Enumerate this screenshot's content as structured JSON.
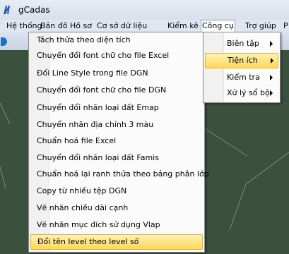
{
  "window": {
    "title": "gCadas"
  },
  "menubar": {
    "items": [
      "Hệ thống",
      "Bản đồ",
      "Hồ sơ",
      "Cơ sở dữ liệu",
      "Kiểm kê",
      "Công cụ",
      "Trợ giúp",
      "P"
    ],
    "active": "Công cụ"
  },
  "dropdown": {
    "items": [
      "Tách thửa theo diện tích",
      "Chuyển đổi font chữ cho file Excel",
      "Đổi Line Style trong file DGN",
      "Chuyển đổi font chữ cho file DGN",
      "Chuyển đổi nhãn loại đất Emap",
      "Chuyển nhãn địa chính 3 màu",
      "Chuẩn hoá file Excel",
      "Chuyển đổi nhãn loại đất Famis",
      "Chuẩn hoá lại ranh thửa theo bảng phân lớp",
      "Copy từ nhiều tệp DGN",
      "Vẽ nhãn chiều dài cạnh",
      "Vẽ nhãn mục đích sử dụng Vlap",
      "Đổi tên level theo level số"
    ],
    "highlighted": "Đổi tên level theo level số"
  },
  "submenu": {
    "items": [
      "Biên tập",
      "Tiện ích",
      "Kiểm tra",
      "Xử lý sổ bộ"
    ],
    "highlighted": "Tiện ích"
  },
  "colors": {
    "canvas": "#3a513d",
    "highlight": "#ffd75a",
    "menubar": "#dfe6ef"
  }
}
